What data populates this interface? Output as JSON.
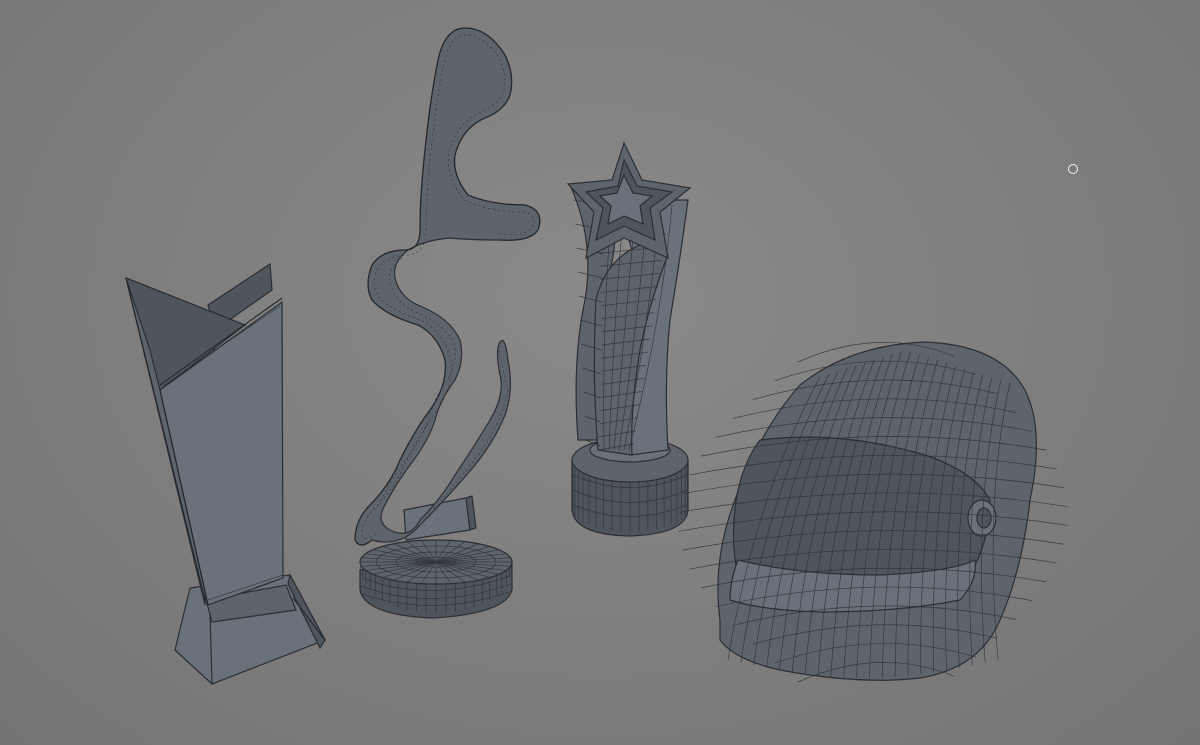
{
  "viewport": {
    "background": "#808080",
    "mesh_fill": "#5d646c",
    "wire_color": "#2d3136",
    "cursor_color": "#f2f2f2"
  },
  "objects": [
    {
      "id": "tall-wing-trophy",
      "icon": "trophy-icon"
    },
    {
      "id": "race-track-trophy",
      "icon": "track-icon"
    },
    {
      "id": "star-trophy",
      "icon": "star-icon"
    },
    {
      "id": "racing-helmet",
      "icon": "helmet-icon"
    }
  ]
}
